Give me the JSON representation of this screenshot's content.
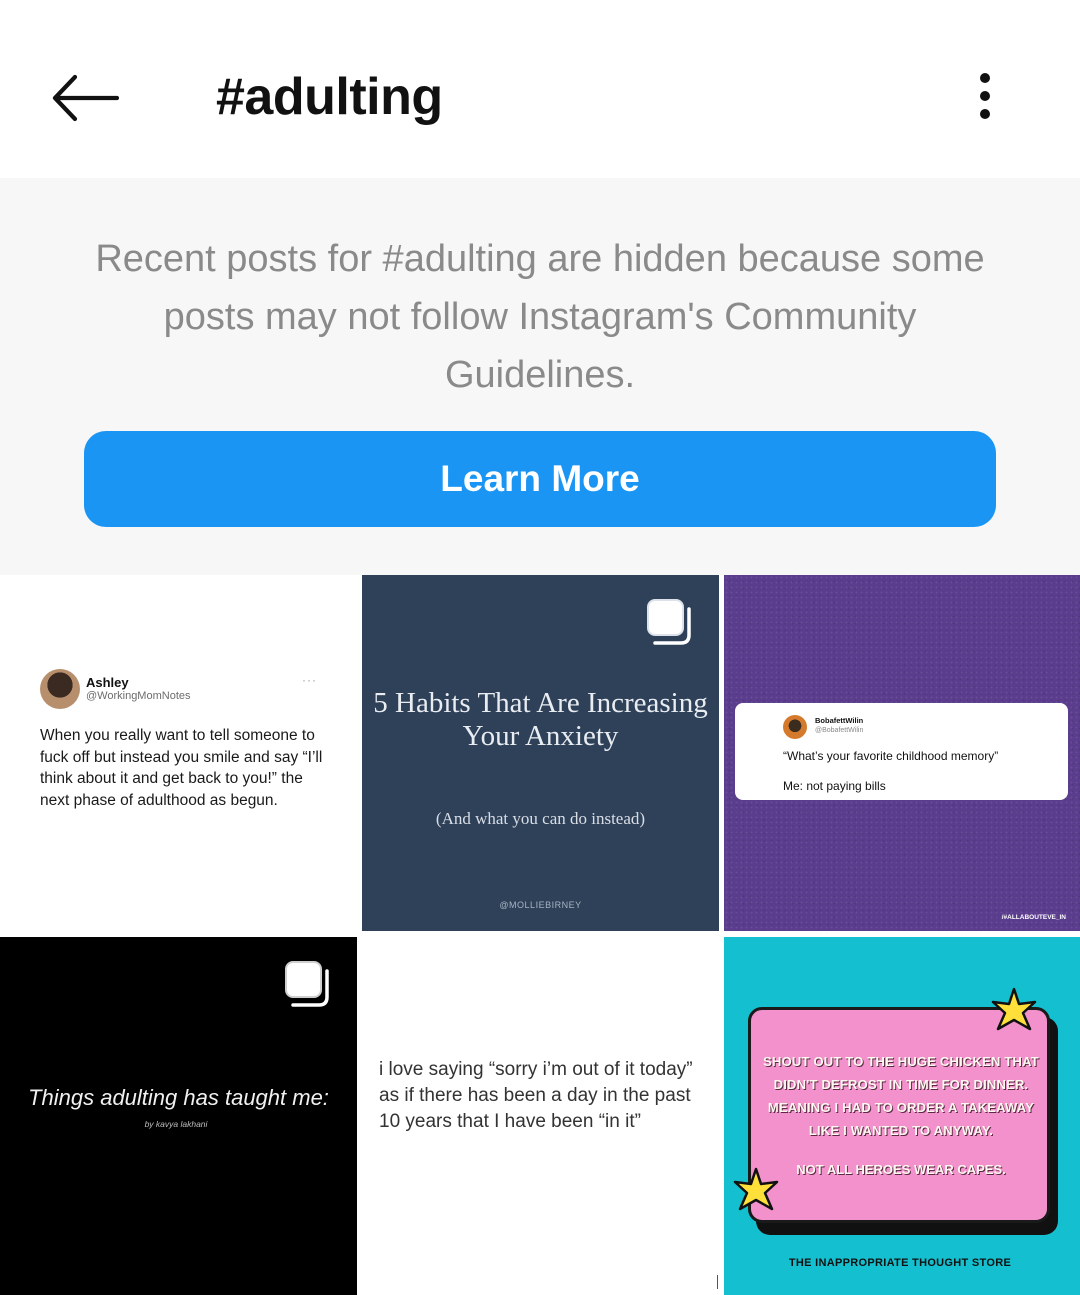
{
  "header": {
    "title": "#adulting",
    "back_icon": "arrow-left-icon",
    "more_icon": "more-vertical-icon"
  },
  "notice": {
    "message": "Recent posts for #adulting are hidden because some posts may not follow Instagram's Community Guidelines.",
    "button_label": "Learn More",
    "button_color": "#1b95f4"
  },
  "posts": [
    {
      "author": "Ashley",
      "handle": "@WorkingMomNotes",
      "menu": "···",
      "text": "When you really want to tell someone to fuck off but instead you smile and say “I’ll think about it and get back to you!” the next phase of adulthood as begun."
    },
    {
      "heading": "5 Habits That Are Increasing Your Anxiety",
      "subheading": "(And what you can do instead)",
      "credit": "@MOLLIEBIRNEY",
      "multi_icon": "carousel-icon"
    },
    {
      "author": "BobafettWilin",
      "handle": "@BobafettWilin",
      "question": "“What’s your favorite childhood memory”",
      "answer": "Me: not paying bills",
      "credit": "/#ALLABOUTEVE_IN"
    },
    {
      "text": "Things adulting has taught me:",
      "byline": "by kavya lakhani",
      "multi_icon": "carousel-icon"
    },
    {
      "text": "i love saying “sorry i’m out of it today” as if there has been a day in the past 10 years that I have been “in it”"
    },
    {
      "message": "SHOUT OUT TO THE HUGE CHICKEN THAT DIDN'T DEFROST IN TIME FOR DINNER. MEANING I HAD TO ORDER A TAKEAWAY LIKE I WANTED TO ANYWAY.",
      "tagline": "NOT ALL HEROES WEAR CAPES.",
      "store": "THE INAPPROPRIATE THOUGHT STORE",
      "icon": "star-icon"
    }
  ]
}
